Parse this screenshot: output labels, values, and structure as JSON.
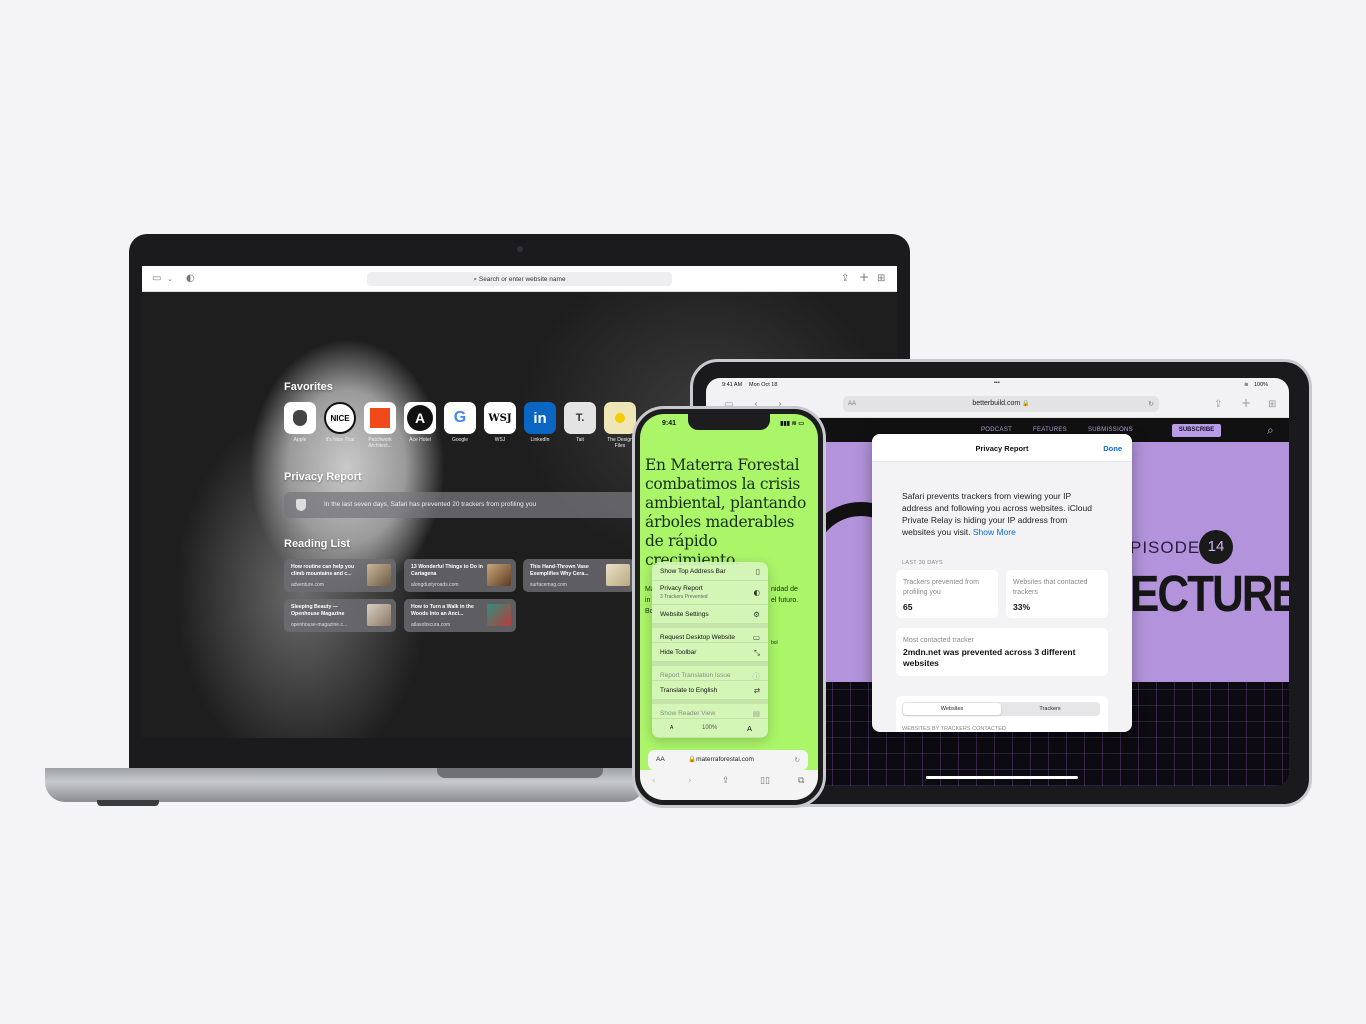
{
  "macbook": {
    "search_placeholder": "Search or enter website name",
    "favorites_title": "Favorites",
    "favorites": [
      {
        "label": "Apple",
        "glyph": "",
        "bg": "#ffffff",
        "fg": "#333333"
      },
      {
        "label": "It's Nice That",
        "glyph": "NICE",
        "bg": "#ffffff",
        "fg": "#111111"
      },
      {
        "label": "Patchwork Architect...",
        "glyph": "",
        "bg": "#ffffff",
        "fg": "#ffffff"
      },
      {
        "label": "Ace Hotel",
        "glyph": "A",
        "bg": "#ffffff",
        "fg": "#111111"
      },
      {
        "label": "Google",
        "glyph": "G",
        "bg": "#ffffff",
        "fg": "#4285f4"
      },
      {
        "label": "WSJ",
        "glyph": "WSJ",
        "bg": "#ffffff",
        "fg": "#111111"
      },
      {
        "label": "LinkedIn",
        "glyph": "in",
        "bg": "#0a66c2",
        "fg": "#ffffff"
      },
      {
        "label": "Tait",
        "glyph": "T.",
        "bg": "#e9e9e9",
        "fg": "#333333"
      },
      {
        "label": "The Design Files",
        "glyph": "",
        "bg": "#f3e28a",
        "fg": "#f3c400"
      }
    ],
    "privacy_title": "Privacy Report",
    "privacy_text": "In the last seven days, Safari has prevented 20 trackers from profiling you",
    "reading_title": "Reading List",
    "reading": [
      {
        "title": "How routine can help you climb mountains and c...",
        "url": "adventure.com"
      },
      {
        "title": "13 Wonderful Things to Do in Cartagena",
        "url": "alongdustyroads.com"
      },
      {
        "title": "This Hand-Thrown Vase Exemplifies Why Cera...",
        "url": "surfacemag.com"
      },
      {
        "title": "Sleeping Beauty — Openhouse Magazine",
        "url": "openhouse-magazine.c..."
      },
      {
        "title": "How to Turn a Walk in the Woods Into an Anci...",
        "url": "atlasobscura.com"
      }
    ]
  },
  "ipad": {
    "time": "9:41 AM",
    "date": "Mon Oct 18",
    "battery": "100%",
    "url": "betterbuild.com",
    "nav": [
      "PODCAST",
      "FEATURES",
      "SUBMISSIONS"
    ],
    "subscribe": "SUBSCRIBE",
    "episode_label": "PISODE",
    "episode_num": "14",
    "hero_title": "ECTURE",
    "privacy_report": {
      "title": "Privacy Report",
      "done": "Done",
      "body": "Safari prevents trackers from viewing your IP address and following you across websites. iCloud Private Relay is hiding your IP address from websites you visit.",
      "show_more": "Show More",
      "period": "LAST 30 DAYS",
      "trackers_label": "Trackers prevented from profiling you",
      "trackers_value": "65",
      "sites_label": "Websites that contacted trackers",
      "sites_value": "33%",
      "most_label": "Most contacted tracker",
      "most_value": "2mdn.net was prevented across 3 different websites",
      "seg_websites": "Websites",
      "seg_trackers": "Trackers",
      "list_caption": "WEBSITES BY TRACKERS CONTACTED"
    }
  },
  "iphone": {
    "time": "9:41",
    "headline": "En Materra Forestal combatimos la crisis ambiental, plantando árboles maderables de rápido crecimiento.",
    "menu": {
      "show_top_address_bar": "Show Top Address Bar",
      "privacy_report": "Privacy Report",
      "privacy_sub": "3 Trackers Prevented",
      "website_settings": "Website Settings",
      "request_desktop": "Request Desktop Website",
      "hide_toolbar": "Hide Toolbar",
      "report_translation": "Report Translation Issue",
      "translate_english": "Translate to English",
      "show_reader": "Show Reader View",
      "font_small": "A",
      "zoom": "100%",
      "font_large": "A"
    },
    "body_fragments": {
      "a": "Ma",
      "b": "nidad de",
      "c": "in",
      "d": "el futuro.",
      "e": "Bo",
      "f": "bol"
    },
    "url_aa": "AA",
    "url": "materraforestal.com"
  }
}
